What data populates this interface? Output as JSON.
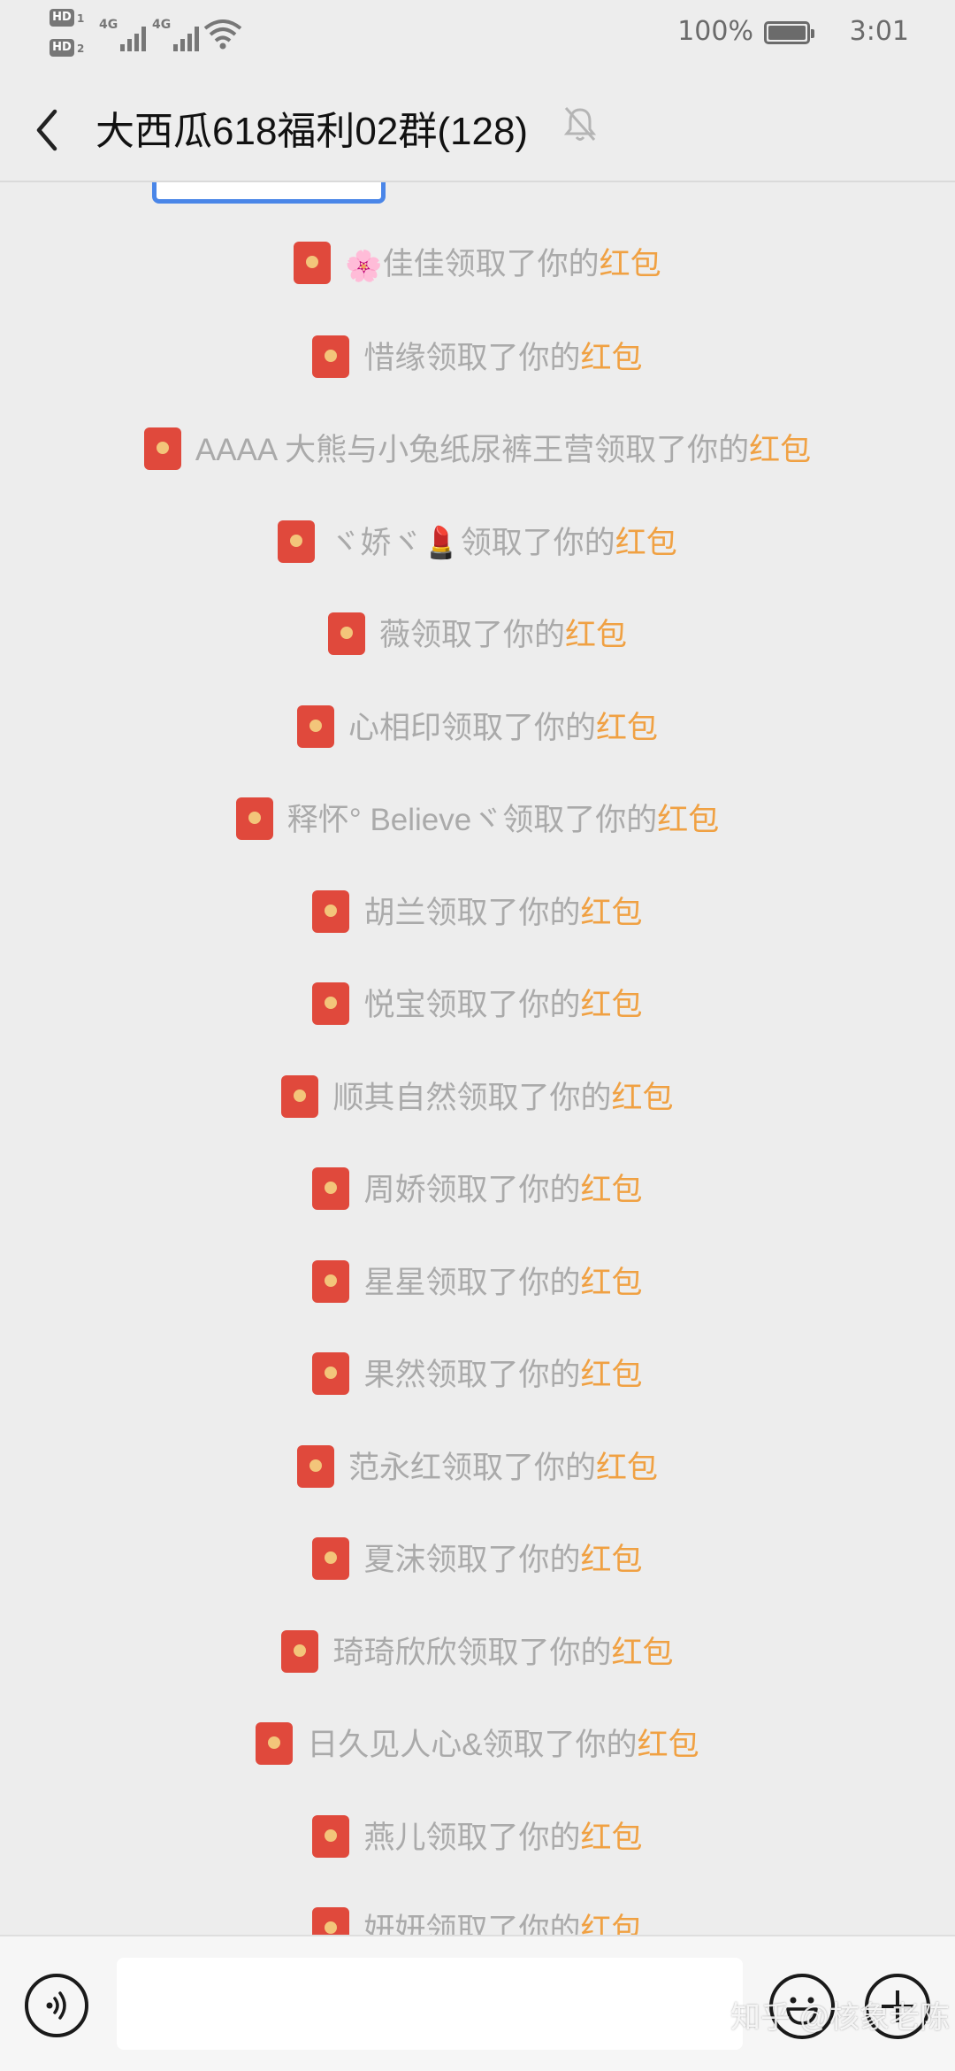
{
  "status_bar": {
    "hd1": "HD",
    "hd1_sub": "1",
    "hd2": "HD",
    "hd2_sub": "2",
    "net1": "4G",
    "net2": "4G",
    "battery_percent": "100%",
    "time": "3:01",
    "icons": [
      "signal-icon",
      "wifi-icon",
      "battery-icon"
    ]
  },
  "header": {
    "title": "大西瓜618福利02群(128)",
    "back_icon": "back-arrow-icon",
    "mute_icon": "bell-off-icon"
  },
  "notices": [
    {
      "prefix": "🌸",
      "name": "佳佳",
      "action": "领取了你的",
      "link": "红包"
    },
    {
      "prefix": "",
      "name": "惜缘",
      "action": "领取了你的",
      "link": "红包"
    },
    {
      "prefix": "",
      "name": "AAAA 大熊与小兔纸尿裤王营",
      "action": "领取了你的",
      "link": "红包"
    },
    {
      "prefix": "",
      "name": "ヾ娇ヾ💄",
      "action": "领取了你的",
      "link": "红包"
    },
    {
      "prefix": "",
      "name": "薇",
      "action": "领取了你的",
      "link": "红包"
    },
    {
      "prefix": "",
      "name": "心相印",
      "action": "领取了你的",
      "link": "红包"
    },
    {
      "prefix": "",
      "name": "释怀° Believeヾ",
      "action": "领取了你的",
      "link": "红包"
    },
    {
      "prefix": "",
      "name": "胡兰",
      "action": "领取了你的",
      "link": "红包"
    },
    {
      "prefix": "",
      "name": "悦宝",
      "action": "领取了你的",
      "link": "红包"
    },
    {
      "prefix": "",
      "name": "顺其自然",
      "action": "领取了你的",
      "link": "红包"
    },
    {
      "prefix": "",
      "name": "周娇",
      "action": "领取了你的",
      "link": "红包"
    },
    {
      "prefix": "",
      "name": "星星",
      "action": "领取了你的",
      "link": "红包"
    },
    {
      "prefix": "",
      "name": "果然",
      "action": "领取了你的",
      "link": "红包"
    },
    {
      "prefix": "",
      "name": "范永红",
      "action": "领取了你的",
      "link": "红包"
    },
    {
      "prefix": "",
      "name": "夏沫",
      "action": "领取了你的",
      "link": "红包"
    },
    {
      "prefix": "",
      "name": "琦琦欣欣",
      "action": "领取了你的",
      "link": "红包"
    },
    {
      "prefix": "",
      "name": "日久见人心&",
      "action": "领取了你的",
      "link": "红包"
    },
    {
      "prefix": "",
      "name": "燕儿",
      "action": "领取了你的",
      "link": "红包"
    },
    {
      "prefix": "",
      "name": "妍妍",
      "action": "领取了你的",
      "link": "红包"
    }
  ],
  "bottom_bar": {
    "input_value": "",
    "voice_icon": "voice-icon",
    "emoji_icon": "emoji-icon",
    "plus_icon": "plus-icon"
  },
  "watermark": "知乎 @核象老陈",
  "colors": {
    "background": "#ededed",
    "notice_text": "#aaaaaa",
    "red_packet_link": "#f0a143",
    "red_packet_icon": "#e0493c"
  }
}
